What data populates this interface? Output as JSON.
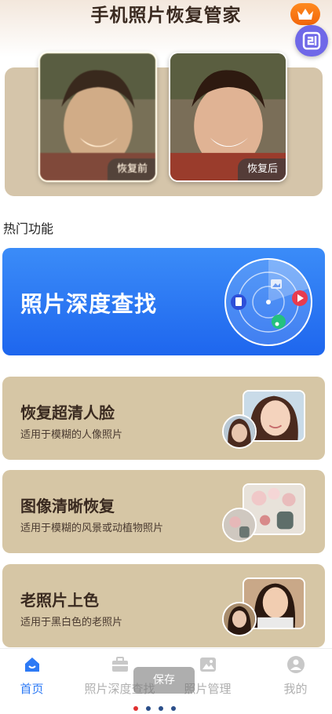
{
  "app": {
    "title": "手机照片恢复管家"
  },
  "header": {
    "vip_icon": "crown-icon",
    "float_icon": "app-logo-icon"
  },
  "compare": {
    "before_label": "恢复前",
    "after_label": "恢复后"
  },
  "section": {
    "title": "热门功能"
  },
  "deep_search": {
    "title": "照片深度查找"
  },
  "features": [
    {
      "title": "恢复超清人脸",
      "subtitle": "适用于模糊的人像照片"
    },
    {
      "title": "图像清晰恢复",
      "subtitle": "适用于模糊的风景或动植物照片"
    },
    {
      "title": "老照片上色",
      "subtitle": "适用于黑白色的老照片"
    }
  ],
  "tabs": [
    {
      "label": "首页",
      "icon": "home-icon",
      "active": true
    },
    {
      "label": "照片深度查找",
      "icon": "briefcase-icon"
    },
    {
      "label": "照片管理",
      "icon": "image-icon"
    },
    {
      "label": "我的",
      "icon": "profile-icon"
    }
  ],
  "toast": {
    "text": "保存"
  },
  "colors": {
    "accent": "#2d7af5",
    "card": "#d6c6a5",
    "vip": "#f2660a"
  }
}
